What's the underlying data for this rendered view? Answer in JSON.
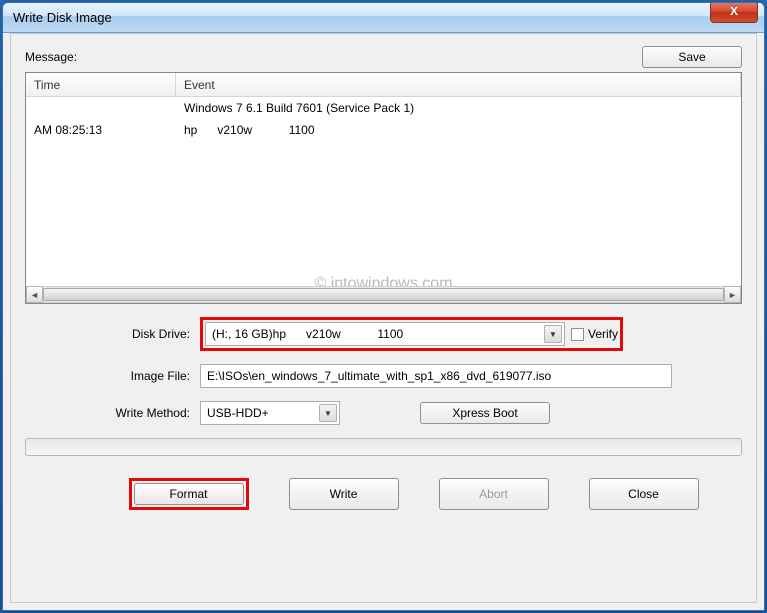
{
  "window": {
    "title": "Write Disk Image",
    "close_icon": "X"
  },
  "message_section": {
    "label": "Message:",
    "save_button": "Save",
    "columns": {
      "time": "Time",
      "event": "Event"
    },
    "rows": [
      {
        "time": "",
        "event": "Windows 7 6.1 Build 7601 (Service Pack 1)"
      },
      {
        "time": "AM 08:25:13",
        "event": "hp      v210w           1100"
      }
    ]
  },
  "watermark": "© intowindows.com",
  "form": {
    "disk_drive_label": "Disk Drive:",
    "disk_drive_value": "(H:, 16 GB)hp      v210w           1100",
    "verify_label": "Verify",
    "image_file_label": "Image File:",
    "image_file_value": "E:\\ISOs\\en_windows_7_ultimate_with_sp1_x86_dvd_619077.iso",
    "write_method_label": "Write Method:",
    "write_method_value": "USB-HDD+",
    "xpress_boot_button": "Xpress Boot"
  },
  "buttons": {
    "format": "Format",
    "write": "Write",
    "abort": "Abort",
    "close": "Close"
  }
}
